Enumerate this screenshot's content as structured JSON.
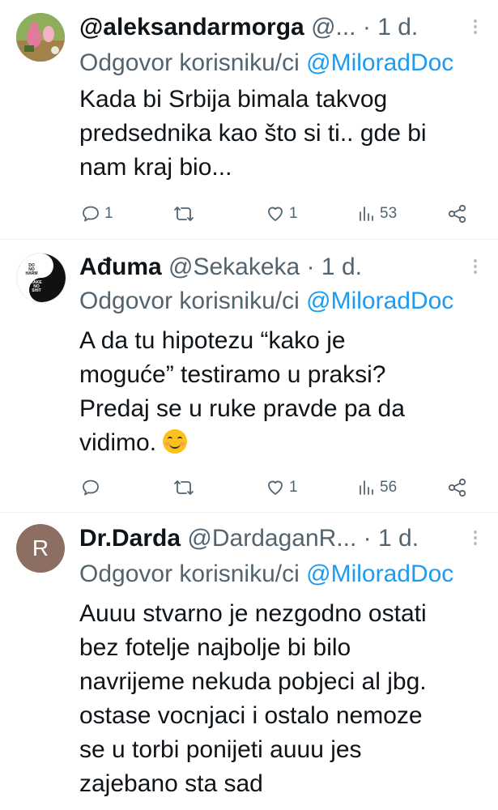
{
  "replies": [
    {
      "name": "@aleksandarmorga",
      "handle": "@...",
      "dot": "·",
      "time": "1 d.",
      "reply_prefix": "Odgovor korisniku/ci",
      "reply_mention": "@MiloradDoc",
      "text_lines": [
        "Kada bi Srbija bimala takvog",
        "predsednika kao što si ti.. gde bi",
        "nam kraj bio..."
      ],
      "stats": {
        "replies": "1",
        "retweets": "",
        "likes": "1",
        "views": "53"
      }
    },
    {
      "name": "Ađuma",
      "handle": "@Sekakeka",
      "dot": "·",
      "time": "1 d.",
      "reply_prefix": "Odgovor korisniku/ci",
      "reply_mention": "@MiloradDoc",
      "text_lines": [
        "A da tu hipotezu “kako je",
        "moguće” testiramo u praksi?",
        "Predaj se u ruke pravde pa da",
        "vidimo."
      ],
      "avatar_text_top": [
        "DO",
        "NO",
        "HARM"
      ],
      "avatar_text_bottom": [
        "TAKE",
        "NO",
        "SHIT"
      ],
      "stats": {
        "replies": "",
        "retweets": "",
        "likes": "1",
        "views": "56"
      }
    },
    {
      "name": "Dr.Darda",
      "handle": "@DardaganR...",
      "dot": "·",
      "time": "1 d.",
      "reply_prefix": "Odgovor korisniku/ci",
      "reply_mention": "@MiloradDoc",
      "avatar_letter": "R",
      "text_lines": [
        "Auuu stvarno je nezgodno ostati",
        "bez fotelje najbolje bi bilo",
        "navrijeme nekuda pobjeci al jbg.",
        "ostase vocnjaci i ostalo nemoze",
        "se u torbi ponijeti auuu jes",
        "zajebano sta sad"
      ]
    }
  ],
  "colors": {
    "link": "#1d9bf0",
    "secondary": "#536471",
    "avatar_r_bg": "#8d6e63"
  }
}
